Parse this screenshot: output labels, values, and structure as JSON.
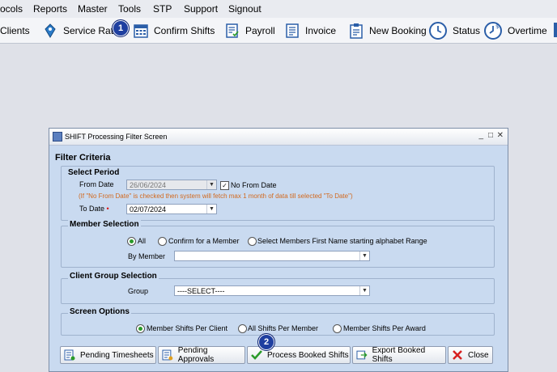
{
  "menu": [
    "ocols",
    "Reports",
    "Master",
    "Tools",
    "STP",
    "Support",
    "Signout"
  ],
  "toolbar": {
    "clients": "Clients",
    "service_rate": "Service Rate",
    "confirm_shifts": "Confirm Shifts",
    "payroll": "Payroll",
    "invoice": "Invoice",
    "new_booking": "New Booking",
    "status": "Status",
    "overtime": "Overtime"
  },
  "badges": {
    "one": "1",
    "two": "2"
  },
  "dialog": {
    "title": "SHIFT Processing Filter Screen",
    "win_min": "_",
    "win_max": "□",
    "win_close": "✕",
    "filter_criteria": "Filter Criteria",
    "select_period": "Select Period",
    "from_date_label": "From Date",
    "from_date_value": "26/06/2024",
    "no_from_date_label": "No From Date",
    "no_from_date_checked": "✓",
    "note": "(If \"No From Date\" is checked then system will fetch max 1 month of data till selected \"To Date\")",
    "to_date_label": "To Date",
    "required_mark": "•",
    "to_date_value": "02/07/2024",
    "member_selection": "Member Selection",
    "radio_all": "All",
    "radio_confirm_member": "Confirm for a Member",
    "radio_alpha_range": "Select Members First Name starting alphabet Range",
    "by_member_label": "By Member",
    "by_member_value": "",
    "client_group_selection": "Client Group Selection",
    "group_label": "Group",
    "group_value": "----SELECT----",
    "screen_options": "Screen Options",
    "opt_member_per_client": "Member Shifts Per Client",
    "opt_all_shifts_per_member": "All Shifts Per Member",
    "opt_member_per_award": "Member Shifts Per Award",
    "dropdown_arrow": "▼"
  },
  "buttons": {
    "pending_timesheets": "Pending Timesheets",
    "pending_approvals": "Pending Approvals",
    "process_booked_shifts": "Process Booked Shifts",
    "export_booked_shifts": "Export Booked Shifts",
    "close": "Close"
  }
}
